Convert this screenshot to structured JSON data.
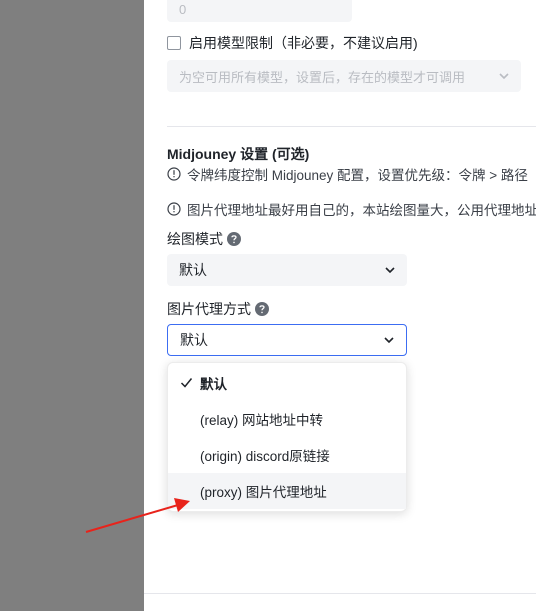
{
  "top_input": {
    "value": "0"
  },
  "model_limit": {
    "label": "启用模型限制（非必要，不建议启用)",
    "checked": false
  },
  "models_select": {
    "placeholder": "为空可用所有模型，设置后，存在的模型才可调用"
  },
  "midjourney": {
    "title": "Midjouney 设置 (可选)",
    "note_1": "令牌纬度控制 Midjouney 配置，设置优先级：令牌 > 路径",
    "note_2": "图片代理地址最好用自己的，本站绘图量大，公用代理地址"
  },
  "draw_mode": {
    "label": "绘图模式",
    "value": "默认"
  },
  "image_proxy": {
    "label": "图片代理方式",
    "value": "默认",
    "options": [
      {
        "label": "默认",
        "selected": true
      },
      {
        "label": "(relay) 网站地址中转",
        "selected": false
      },
      {
        "label": "(origin) discord原链接",
        "selected": false
      },
      {
        "label": "(proxy) 图片代理地址",
        "selected": false,
        "hovered": true
      }
    ]
  },
  "icons": [
    "info-icon",
    "help-icon",
    "chevron-down-icon",
    "check-icon",
    "red-arrow-annotation"
  ],
  "colors": {
    "accent": "#3c6df2",
    "overlay": "#7f7f7f",
    "annotation": "#e8231b"
  }
}
